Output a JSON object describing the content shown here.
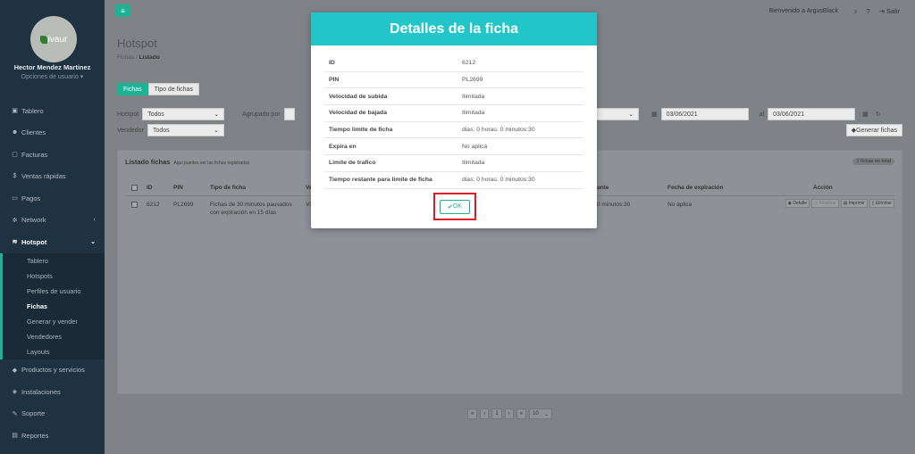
{
  "sidebar": {
    "logo_text": "ivaur",
    "user_name": "Hector Mendez Martinez",
    "user_options": "Opciones de usuario ▾",
    "items": [
      {
        "label": "Tablero",
        "icon": "dashboard-icon"
      },
      {
        "label": "Clientes",
        "icon": "users-icon"
      },
      {
        "label": "Facturas",
        "icon": "file-icon"
      },
      {
        "label": "Ventas rápidas",
        "icon": "dollar-icon"
      },
      {
        "label": "Pagos",
        "icon": "money-icon"
      },
      {
        "label": "Network",
        "icon": "network-icon"
      },
      {
        "label": "Hotspot",
        "icon": "wifi-icon"
      }
    ],
    "hotspot_sub": [
      "Tablero",
      "Hotspots",
      "Perfiles de usuario",
      "Fichas",
      "Generar y vender",
      "Vendedores",
      "Layouts"
    ],
    "items_after": [
      {
        "label": "Productos y servicios",
        "icon": "tag-icon"
      },
      {
        "label": "Instalaciones",
        "icon": "install-icon"
      },
      {
        "label": "Soporte",
        "icon": "wrench-icon"
      },
      {
        "label": "Reportes",
        "icon": "book-icon"
      }
    ]
  },
  "topbar": {
    "welcome": "Bienvenido a ArgusBlack",
    "logout": "Salir"
  },
  "main": {
    "title": "Hotspot",
    "breadcrumb_parent": "Fichas",
    "breadcrumb_current": "Listado",
    "tabs": [
      "Fichas",
      "Tipo de fichas"
    ],
    "filters": {
      "hotspot_label": "Hotspot",
      "hotspot_value": "Todos",
      "grouped_label": "Agrupado por",
      "seller_label": "Vendedor",
      "seller_value": "Todos",
      "date_from": "03/06/2021",
      "date_sep": "al",
      "date_to": "03/06/2021",
      "generate_button": "Generar fichas"
    },
    "list": {
      "title": "Listado fichas",
      "subtitle": "Aquí puedes ver las fichas registradas",
      "count": "1 fichas en total",
      "headers": [
        "ID",
        "PIN",
        "Tipo de ficha",
        "Ve",
        "ante",
        "Fecha de expiración",
        "Acción"
      ],
      "row": {
        "id": "6212",
        "pin": "PL2699",
        "type": "Fichas de 30 minutos pausados con expiración en 15 días",
        "seller": "Vi",
        "remaining": "0 minutos:30",
        "expiration": "No aplica"
      },
      "actions": [
        "Detalle",
        "Finalizar",
        "Imprimir",
        "Eliminar"
      ]
    },
    "pager": {
      "first": "«",
      "prev": "‹",
      "page": "1",
      "next": "›",
      "last": "»",
      "per_page": "10"
    }
  },
  "modal": {
    "title": "Detalles de la ficha",
    "rows": [
      {
        "k": "ID",
        "v": "6212"
      },
      {
        "k": "PIN",
        "v": "PL2699"
      },
      {
        "k": "Velocidad de subida",
        "v": "Ilimitada"
      },
      {
        "k": "Velocidad de bajada",
        "v": "Ilimitada"
      },
      {
        "k": "Tiempo limite de ficha",
        "v": "dias: 0 horas: 0 minutos:30"
      },
      {
        "k": "Expira en",
        "v": "No aplica"
      },
      {
        "k": "Limite de trafico",
        "v": "Ilimitada"
      },
      {
        "k": "Tiempo restante para limite de ficha",
        "v": "dias: 0 horas: 0 minutos:30"
      }
    ],
    "ok_label": "OK"
  }
}
